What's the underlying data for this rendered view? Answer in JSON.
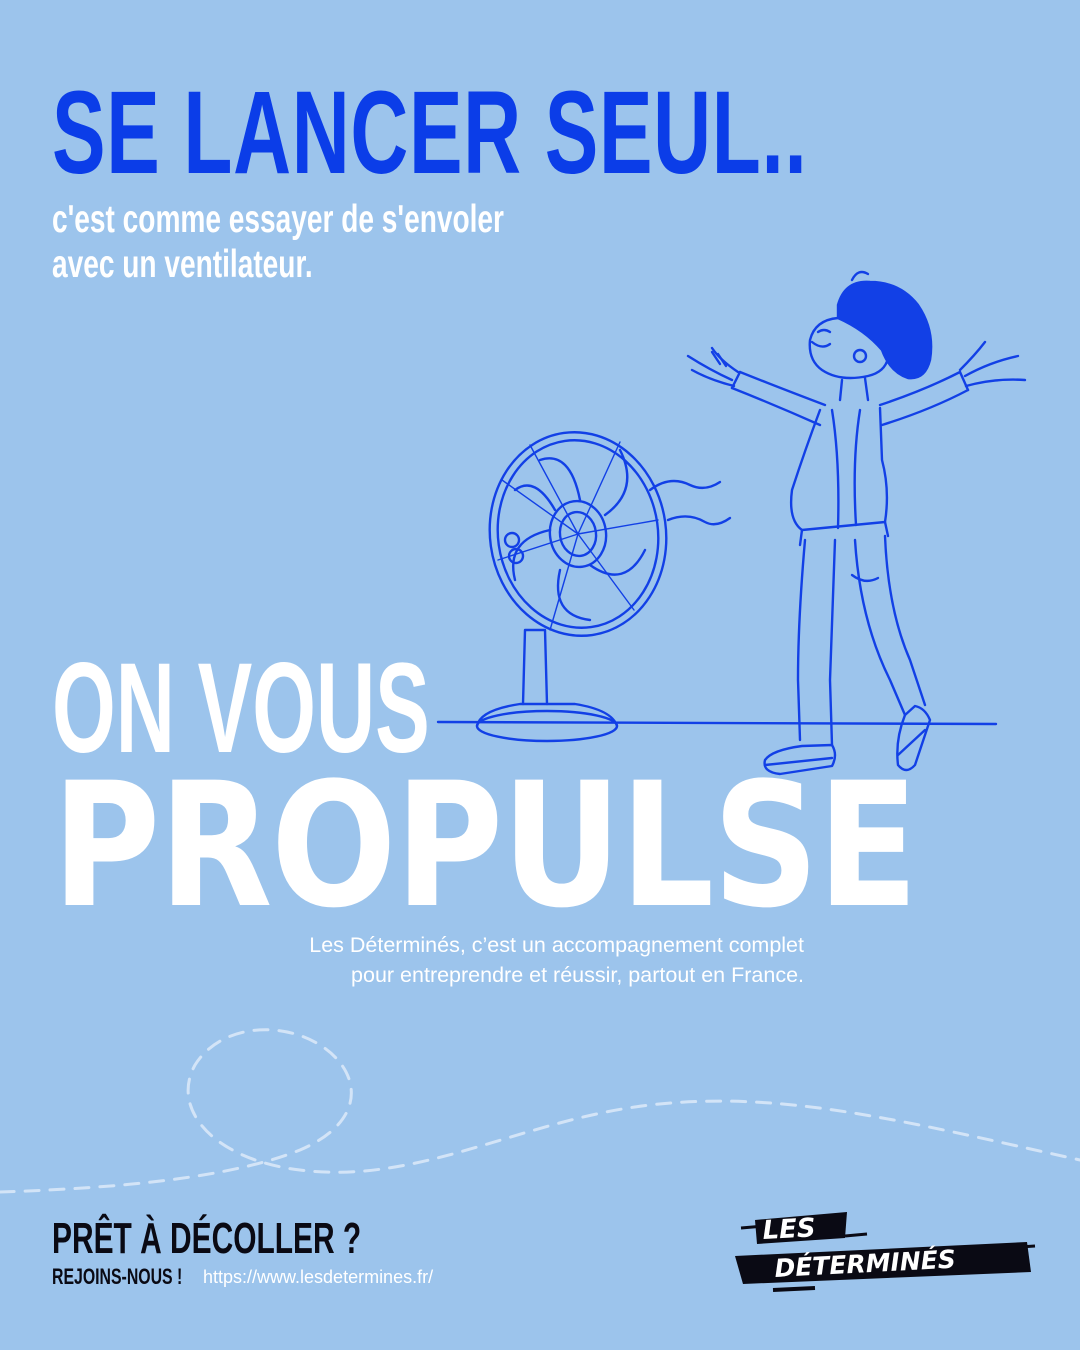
{
  "headline": "SE LANCER SEUL..",
  "subtitle": {
    "line1": "c'est comme essayer de s'envoler",
    "line2": "avec un ventilateur."
  },
  "tagline": {
    "line1": "ON VOUS",
    "line2": "PROPULSE"
  },
  "description": {
    "line1": "Les Déterminés, c’est un accompagnement complet",
    "line2": "pour entreprendre et réussir, partout en France."
  },
  "cta": {
    "title": "PRÊT À DÉCOLLER ?",
    "join": "REJOINS-NOUS !",
    "url": "https://www.lesdetermines.fr/"
  },
  "logo": {
    "line1": "LES",
    "line2": "DÉTERMINÉS"
  },
  "colors": {
    "background": "#9cc4ec",
    "accent_blue": "#0b3de8",
    "text_white": "#ffffff",
    "text_dark": "#0a0a14"
  },
  "icons": [
    "fan-icon",
    "person-icon",
    "logo-mark"
  ]
}
